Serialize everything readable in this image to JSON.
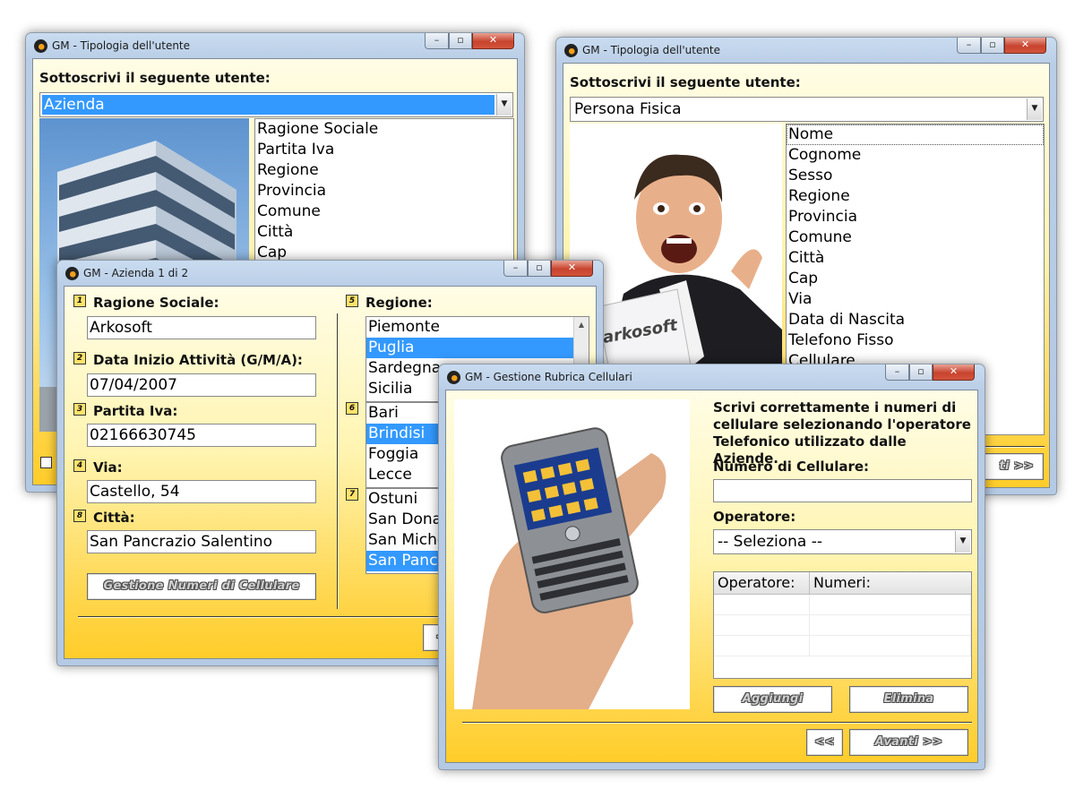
{
  "colors": {
    "selection": "#3399ff",
    "client_top": "#fffde6",
    "client_bottom": "#ffcd2a"
  },
  "tip1": {
    "title": "GM - Tipologia dell'utente",
    "heading": "Sottoscrivi il seguente utente:",
    "select_value": "Azienda",
    "fields": [
      "Ragione Sociale",
      "Partita Iva",
      "Regione",
      "Provincia",
      "Comune",
      "Città",
      "Cap"
    ]
  },
  "tip2": {
    "title": "GM - Tipologia dell'utente",
    "heading": "Sottoscrivi il seguente utente:",
    "select_value": "Persona Fisica",
    "photo_caption": "arkosoft",
    "fields": [
      "Nome",
      "Cognome",
      "Sesso",
      "Regione",
      "Provincia",
      "Comune",
      "Città",
      "Cap",
      "Via",
      "Data di Nascita",
      "Telefono Fisso",
      "Cellulare"
    ],
    "next_partial": "ti >>"
  },
  "azienda": {
    "title": "GM - Azienda 1 di 2",
    "labels": {
      "ragione_sociale": "Ragione Sociale:",
      "data_inizio": "Data Inizio Attività (G/M/A):",
      "partita_iva": "Partita Iva:",
      "via": "Via:",
      "citta": "Città:",
      "regione": "Regione:"
    },
    "badges": [
      "1",
      "2",
      "3",
      "4",
      "8",
      "5",
      "6",
      "7"
    ],
    "values": {
      "ragione_sociale": "Arkosoft",
      "data_inizio": "07/04/2007",
      "partita_iva": "02166630745",
      "via": "Castello, 54",
      "citta": "San Pancrazio Salentino"
    },
    "button_cellulari": "Gestione Numeri di Cellulare",
    "regioni": [
      "Piemonte",
      "Puglia",
      "Sardegna",
      "Sicilia"
    ],
    "province": [
      "Bari",
      "Brindisi",
      "Foggia",
      "Lecce"
    ],
    "comuni": [
      "Ostuni",
      "San Dona",
      "San Miche",
      "San Panc"
    ],
    "back_partial": "<"
  },
  "rubrica": {
    "title": "GM - Gestione Rubrica Cellulari",
    "instructions": "Scrivi correttamente i numeri di cellulare selezionando l'operatore Telefonico utilizzato dalle Aziende.",
    "numero_label": "Numero di Cellulare:",
    "numero_value": "",
    "operatore_label": "Operatore:",
    "operatore_value": "-- Seleziona --",
    "grid_headers": [
      "Operatore:",
      "Numeri:"
    ],
    "btn_aggiungi": "Aggiungi",
    "btn_elimina": "Elimina",
    "btn_back": "<<",
    "btn_next": "Avanti >>"
  }
}
